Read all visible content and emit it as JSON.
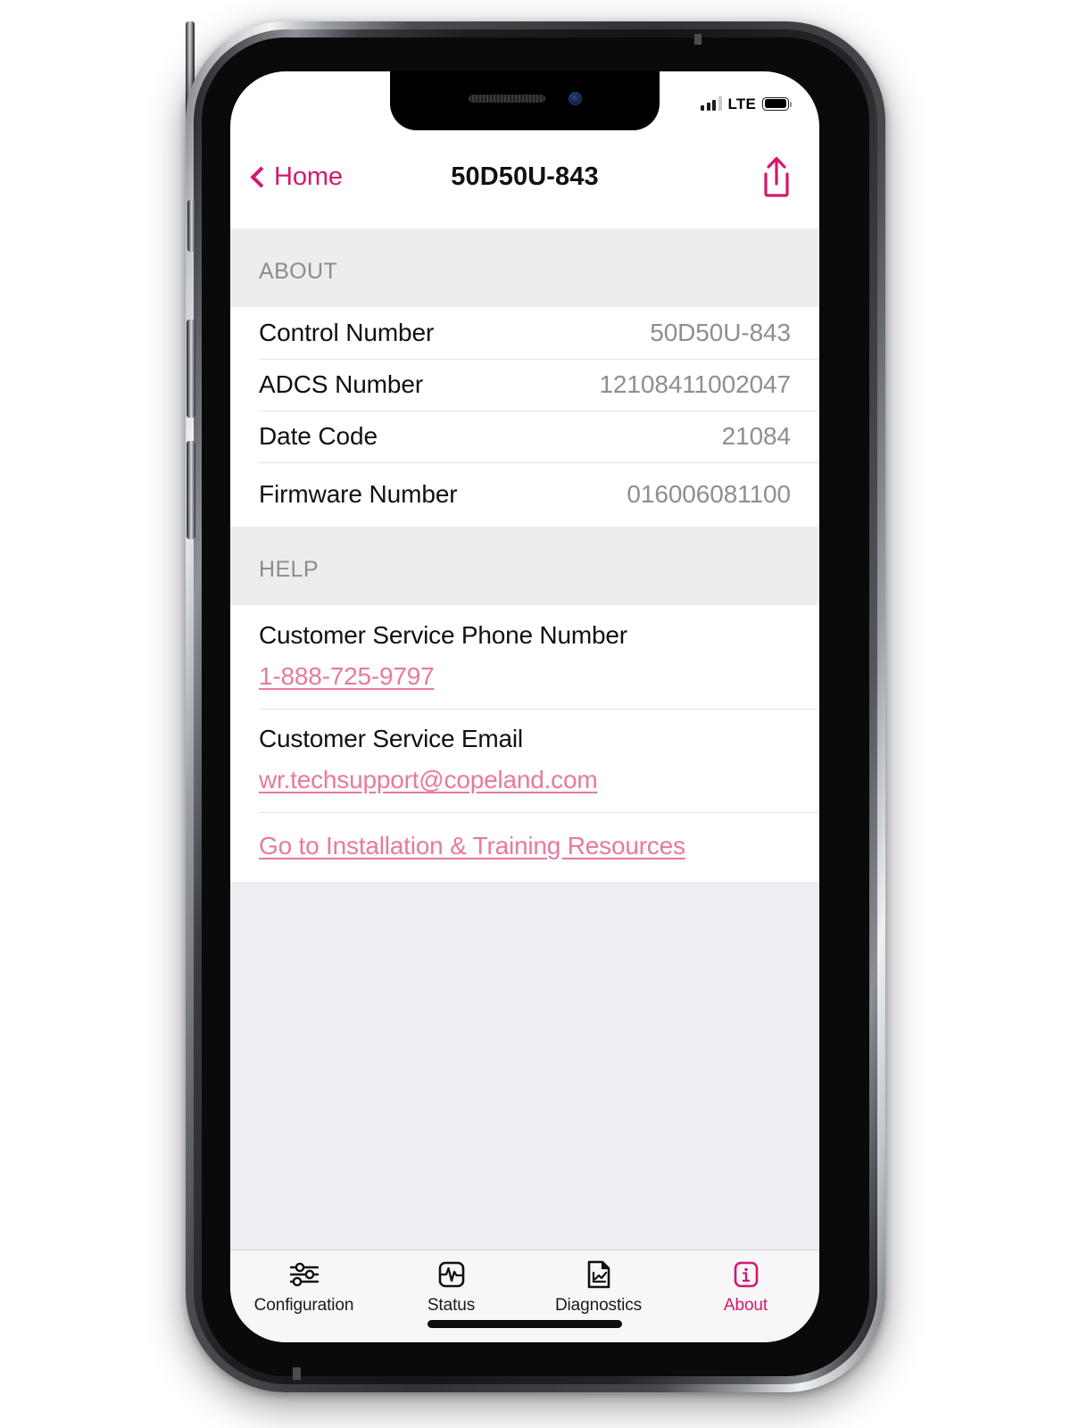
{
  "status_bar": {
    "network": "LTE",
    "signal_bars_total": 4,
    "signal_bars_filled": 3,
    "battery_full": true
  },
  "navbar": {
    "back_label": "Home",
    "title": "50D50U-843",
    "share_icon": "share-icon",
    "back_icon": "chevron-left-icon",
    "accent_color": "#D4186E"
  },
  "sections": {
    "about": {
      "header": "ABOUT",
      "rows": [
        {
          "label": "Control Number",
          "value": "50D50U-843"
        },
        {
          "label": "ADCS Number",
          "value": "12108411002047"
        },
        {
          "label": "Date Code",
          "value": "21084"
        },
        {
          "label": "Firmware Number",
          "value": "016006081100"
        }
      ]
    },
    "help": {
      "header": "HELP",
      "phone": {
        "label": "Customer Service Phone Number",
        "link": "1-888-725-9797"
      },
      "email": {
        "label": "Customer Service Email",
        "link": "wr.techsupport@copeland.com"
      },
      "resources_link": "Go to Installation & Training Resources",
      "link_color": "#E8799F"
    }
  },
  "tabbar": {
    "tabs": [
      {
        "label": "Configuration",
        "icon": "sliders-icon",
        "active": false
      },
      {
        "label": "Status",
        "icon": "pulse-icon",
        "active": false
      },
      {
        "label": "Diagnostics",
        "icon": "chart-document-icon",
        "active": false
      },
      {
        "label": "About",
        "icon": "info-icon",
        "active": true
      }
    ],
    "active_color": "#D4186E"
  }
}
